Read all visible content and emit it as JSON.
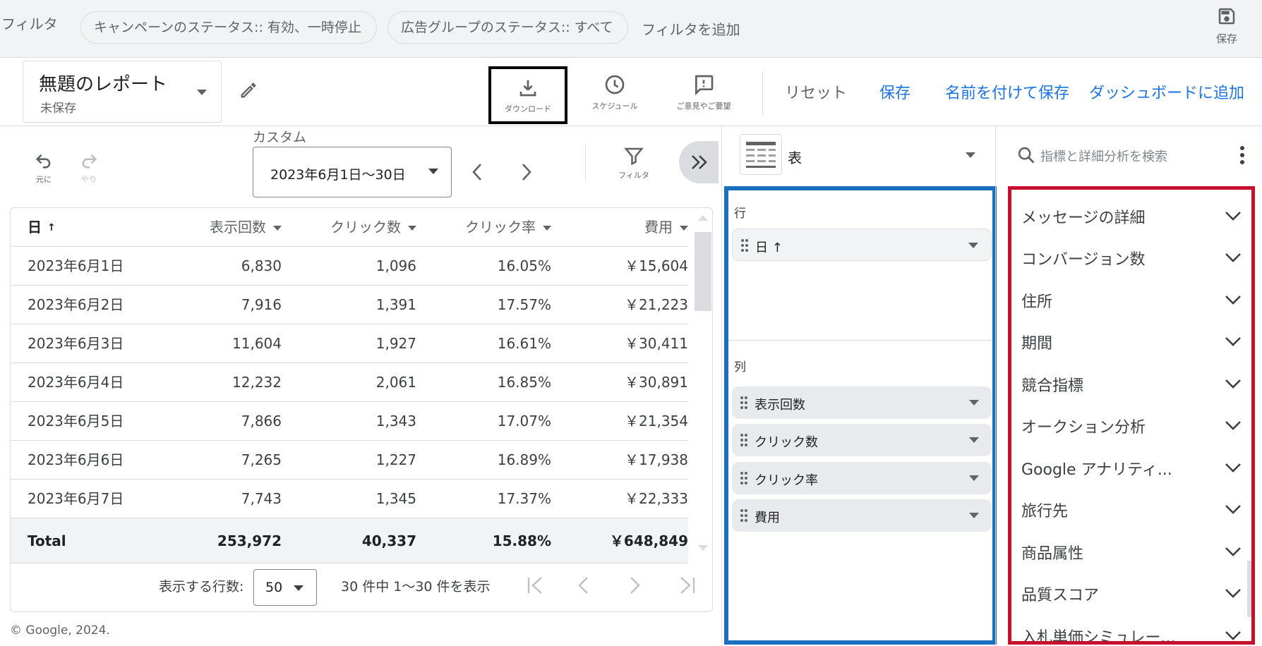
{
  "filter_bar": {
    "label": "フィルタ",
    "chips": [
      "キャンペーンのステータス:: 有効、一時停止",
      "広告グループのステータス:: すべて"
    ],
    "add_filter": "フィルタを追加",
    "save_label": "保存"
  },
  "report": {
    "title": "無題のレポート",
    "subtitle": "未保存"
  },
  "toolbar": {
    "download": "ダウンロード",
    "schedule": "スケジュール",
    "feedback": "ご意見やご要望",
    "reset": "リセット",
    "save": "保存",
    "save_as": "名前を付けて保存",
    "add_dashboard": "ダッシュボードに追加"
  },
  "controls": {
    "undo": "元に",
    "redo": "やり",
    "custom_label": "カスタム",
    "date_range": "2023年6月1日～30日",
    "filter": "フィルタ"
  },
  "table": {
    "headers": [
      "日",
      "表示回数",
      "クリック数",
      "クリック率",
      "費用"
    ],
    "sort_arrow": "↑",
    "rows": [
      [
        "2023年6月1日",
        "6,830",
        "1,096",
        "16.05%",
        "￥15,604"
      ],
      [
        "2023年6月2日",
        "7,916",
        "1,391",
        "17.57%",
        "￥21,223"
      ],
      [
        "2023年6月3日",
        "11,604",
        "1,927",
        "16.61%",
        "￥30,411"
      ],
      [
        "2023年6月4日",
        "12,232",
        "2,061",
        "16.85%",
        "￥30,891"
      ],
      [
        "2023年6月5日",
        "7,866",
        "1,343",
        "17.07%",
        "￥21,354"
      ],
      [
        "2023年6月6日",
        "7,265",
        "1,227",
        "16.89%",
        "￥17,938"
      ],
      [
        "2023年6月7日",
        "7,743",
        "1,345",
        "17.37%",
        "￥22,333"
      ]
    ],
    "total": [
      "Total",
      "253,972",
      "40,337",
      "15.88%",
      "￥648,849"
    ]
  },
  "pagination": {
    "rows_label": "表示する行数:",
    "rows_value": "50",
    "range_text": "30 件中 1～30 件を表示"
  },
  "footer": {
    "copyright": "© Google, 2024."
  },
  "viz": {
    "selected": "表"
  },
  "layout_panel": {
    "rows_label": "行",
    "row_fields": [
      "日  ↑"
    ],
    "cols_label": "列",
    "col_fields": [
      "表示回数",
      "クリック数",
      "クリック率",
      "費用"
    ]
  },
  "metrics_panel": {
    "search_placeholder": "指標と詳細分析を検索",
    "categories": [
      "メッセージの詳細",
      "コンバージョン数",
      "住所",
      "期間",
      "競合指標",
      "オークション分析",
      "Google アナリティ...",
      "旅行先",
      "商品属性",
      "品質スコア",
      "入札単価シミュレー..."
    ]
  },
  "colors": {
    "accent": "#1a73e8",
    "columns_box_border": "#1a6fbf",
    "metrics_box_border": "#c8102e",
    "download_highlight": "#000000"
  },
  "icons": {
    "save": "save-icon",
    "download": "download-icon",
    "schedule": "clock-icon",
    "feedback": "feedback-icon",
    "edit": "pencil-icon",
    "undo": "undo-icon",
    "redo": "redo-icon",
    "filter": "funnel-icon",
    "expand": "double-chevron-right-icon",
    "search": "search-icon",
    "more": "kebab-icon"
  }
}
